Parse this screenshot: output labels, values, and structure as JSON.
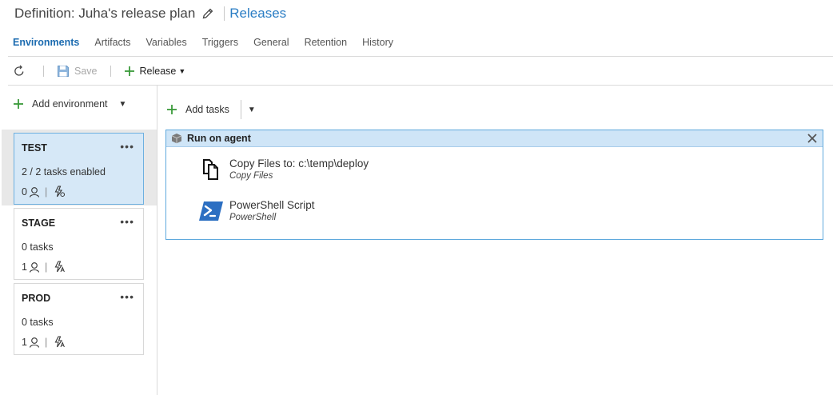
{
  "header": {
    "title": "Definition: Juha's release plan",
    "edit_icon": "pencil-icon",
    "link": "Releases"
  },
  "tabs": [
    {
      "label": "Environments",
      "active": true
    },
    {
      "label": "Artifacts",
      "active": false
    },
    {
      "label": "Variables",
      "active": false
    },
    {
      "label": "Triggers",
      "active": false
    },
    {
      "label": "General",
      "active": false
    },
    {
      "label": "Retention",
      "active": false
    },
    {
      "label": "History",
      "active": false
    }
  ],
  "toolbar": {
    "refresh_icon": "refresh-icon",
    "save_label": "Save",
    "save_icon": "save-icon",
    "release_label": "Release",
    "release_icon": "plus-icon"
  },
  "left": {
    "add_environment_label": "Add environment",
    "environments": [
      {
        "name": "TEST",
        "tasks": "2 / 2 tasks enabled",
        "approvers": "0",
        "selected": true
      },
      {
        "name": "STAGE",
        "tasks": "0 tasks",
        "approvers": "1",
        "selected": false
      },
      {
        "name": "PROD",
        "tasks": "0 tasks",
        "approvers": "1",
        "selected": false
      }
    ],
    "menu_glyph": "•••"
  },
  "right": {
    "add_tasks_label": "Add tasks",
    "phase": {
      "title": "Run on agent",
      "tasks": [
        {
          "name": "Copy Files to: c:\\temp\\deploy",
          "type": "Copy Files",
          "icon": "copy-files-icon"
        },
        {
          "name": "PowerShell Script",
          "type": "PowerShell",
          "icon": "powershell-icon"
        }
      ]
    }
  },
  "colors": {
    "accent": "#1b6bb0",
    "link": "#2a7dc4",
    "add_green": "#3a9a3a",
    "selected_env": "#d6e8f7",
    "phase_header": "#cfe5f7"
  }
}
